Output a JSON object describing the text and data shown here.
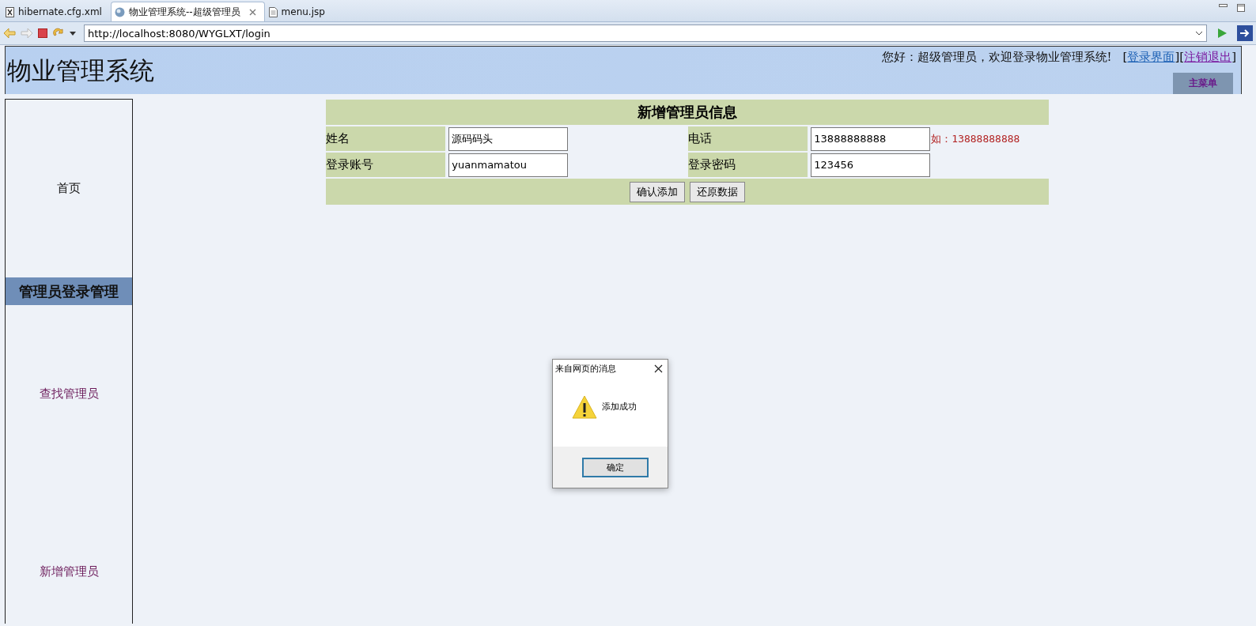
{
  "editor_tabs": [
    {
      "label": "hibernate.cfg.xml",
      "kind": "xml",
      "selected": false,
      "closable": false
    },
    {
      "label": "物业管理系统--超级管理员",
      "kind": "web",
      "selected": true,
      "closable": true
    },
    {
      "label": "menu.jsp",
      "kind": "file",
      "selected": false,
      "closable": false
    }
  ],
  "address_bar": {
    "url": "http://localhost:8080/WYGLXT/login"
  },
  "header": {
    "title": "物业管理系统",
    "greeting": "您好：超级管理员，欢迎登录物业管理系统!",
    "links": [
      {
        "open": "[",
        "label": "登录界面",
        "close": "]",
        "visited": false
      },
      {
        "open": "[",
        "label": "注销退出",
        "close": "]",
        "visited": true
      }
    ],
    "menu_button": "主菜单"
  },
  "sidebar": {
    "items": [
      {
        "label": "首页",
        "kind": "plain"
      },
      {
        "label": "管理员登录管理",
        "kind": "heading"
      },
      {
        "label": "查找管理员",
        "kind": "link"
      },
      {
        "label": "新增管理员",
        "kind": "link"
      }
    ]
  },
  "form": {
    "title": "新增管理员信息",
    "rows": [
      {
        "fields": [
          {
            "label": "姓名",
            "value": "源码码头"
          },
          {
            "label": "电话",
            "value": "13888888888",
            "hint": "如：13888888888"
          }
        ]
      },
      {
        "fields": [
          {
            "label": "登录账号",
            "value": "yuanmamatou"
          },
          {
            "label": "登录密码",
            "value": "123456"
          }
        ]
      }
    ],
    "buttons": [
      "确认添加",
      "还原数据"
    ]
  },
  "dialog": {
    "title": "来自网页的消息",
    "message": "添加成功",
    "button": "确定"
  }
}
